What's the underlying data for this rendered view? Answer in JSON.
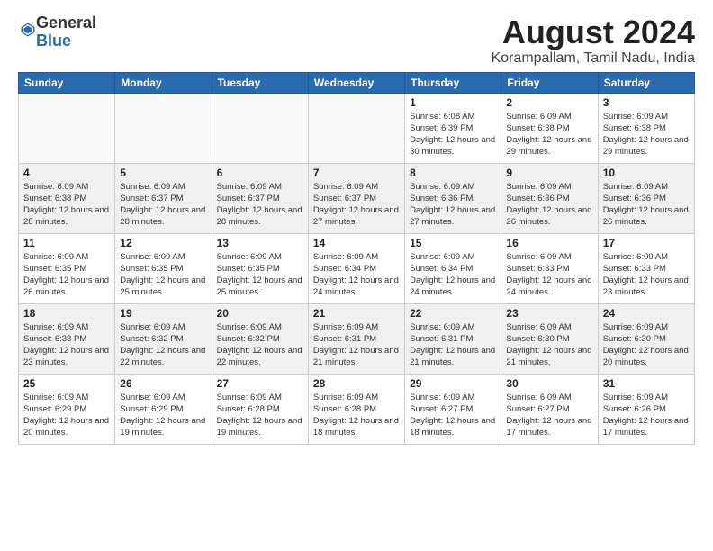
{
  "header": {
    "logo_general": "General",
    "logo_blue": "Blue",
    "main_title": "August 2024",
    "subtitle": "Korampallam, Tamil Nadu, India"
  },
  "weekdays": [
    "Sunday",
    "Monday",
    "Tuesday",
    "Wednesday",
    "Thursday",
    "Friday",
    "Saturday"
  ],
  "weeks": [
    [
      {
        "day": "",
        "info": ""
      },
      {
        "day": "",
        "info": ""
      },
      {
        "day": "",
        "info": ""
      },
      {
        "day": "",
        "info": ""
      },
      {
        "day": "1",
        "info": "Sunrise: 6:08 AM\nSunset: 6:39 PM\nDaylight: 12 hours\nand 30 minutes."
      },
      {
        "day": "2",
        "info": "Sunrise: 6:09 AM\nSunset: 6:38 PM\nDaylight: 12 hours\nand 29 minutes."
      },
      {
        "day": "3",
        "info": "Sunrise: 6:09 AM\nSunset: 6:38 PM\nDaylight: 12 hours\nand 29 minutes."
      }
    ],
    [
      {
        "day": "4",
        "info": "Sunrise: 6:09 AM\nSunset: 6:38 PM\nDaylight: 12 hours\nand 28 minutes."
      },
      {
        "day": "5",
        "info": "Sunrise: 6:09 AM\nSunset: 6:37 PM\nDaylight: 12 hours\nand 28 minutes."
      },
      {
        "day": "6",
        "info": "Sunrise: 6:09 AM\nSunset: 6:37 PM\nDaylight: 12 hours\nand 28 minutes."
      },
      {
        "day": "7",
        "info": "Sunrise: 6:09 AM\nSunset: 6:37 PM\nDaylight: 12 hours\nand 27 minutes."
      },
      {
        "day": "8",
        "info": "Sunrise: 6:09 AM\nSunset: 6:36 PM\nDaylight: 12 hours\nand 27 minutes."
      },
      {
        "day": "9",
        "info": "Sunrise: 6:09 AM\nSunset: 6:36 PM\nDaylight: 12 hours\nand 26 minutes."
      },
      {
        "day": "10",
        "info": "Sunrise: 6:09 AM\nSunset: 6:36 PM\nDaylight: 12 hours\nand 26 minutes."
      }
    ],
    [
      {
        "day": "11",
        "info": "Sunrise: 6:09 AM\nSunset: 6:35 PM\nDaylight: 12 hours\nand 26 minutes."
      },
      {
        "day": "12",
        "info": "Sunrise: 6:09 AM\nSunset: 6:35 PM\nDaylight: 12 hours\nand 25 minutes."
      },
      {
        "day": "13",
        "info": "Sunrise: 6:09 AM\nSunset: 6:35 PM\nDaylight: 12 hours\nand 25 minutes."
      },
      {
        "day": "14",
        "info": "Sunrise: 6:09 AM\nSunset: 6:34 PM\nDaylight: 12 hours\nand 24 minutes."
      },
      {
        "day": "15",
        "info": "Sunrise: 6:09 AM\nSunset: 6:34 PM\nDaylight: 12 hours\nand 24 minutes."
      },
      {
        "day": "16",
        "info": "Sunrise: 6:09 AM\nSunset: 6:33 PM\nDaylight: 12 hours\nand 24 minutes."
      },
      {
        "day": "17",
        "info": "Sunrise: 6:09 AM\nSunset: 6:33 PM\nDaylight: 12 hours\nand 23 minutes."
      }
    ],
    [
      {
        "day": "18",
        "info": "Sunrise: 6:09 AM\nSunset: 6:33 PM\nDaylight: 12 hours\nand 23 minutes."
      },
      {
        "day": "19",
        "info": "Sunrise: 6:09 AM\nSunset: 6:32 PM\nDaylight: 12 hours\nand 22 minutes."
      },
      {
        "day": "20",
        "info": "Sunrise: 6:09 AM\nSunset: 6:32 PM\nDaylight: 12 hours\nand 22 minutes."
      },
      {
        "day": "21",
        "info": "Sunrise: 6:09 AM\nSunset: 6:31 PM\nDaylight: 12 hours\nand 21 minutes."
      },
      {
        "day": "22",
        "info": "Sunrise: 6:09 AM\nSunset: 6:31 PM\nDaylight: 12 hours\nand 21 minutes."
      },
      {
        "day": "23",
        "info": "Sunrise: 6:09 AM\nSunset: 6:30 PM\nDaylight: 12 hours\nand 21 minutes."
      },
      {
        "day": "24",
        "info": "Sunrise: 6:09 AM\nSunset: 6:30 PM\nDaylight: 12 hours\nand 20 minutes."
      }
    ],
    [
      {
        "day": "25",
        "info": "Sunrise: 6:09 AM\nSunset: 6:29 PM\nDaylight: 12 hours\nand 20 minutes."
      },
      {
        "day": "26",
        "info": "Sunrise: 6:09 AM\nSunset: 6:29 PM\nDaylight: 12 hours\nand 19 minutes."
      },
      {
        "day": "27",
        "info": "Sunrise: 6:09 AM\nSunset: 6:28 PM\nDaylight: 12 hours\nand 19 minutes."
      },
      {
        "day": "28",
        "info": "Sunrise: 6:09 AM\nSunset: 6:28 PM\nDaylight: 12 hours\nand 18 minutes."
      },
      {
        "day": "29",
        "info": "Sunrise: 6:09 AM\nSunset: 6:27 PM\nDaylight: 12 hours\nand 18 minutes."
      },
      {
        "day": "30",
        "info": "Sunrise: 6:09 AM\nSunset: 6:27 PM\nDaylight: 12 hours\nand 17 minutes."
      },
      {
        "day": "31",
        "info": "Sunrise: 6:09 AM\nSunset: 6:26 PM\nDaylight: 12 hours\nand 17 minutes."
      }
    ]
  ]
}
